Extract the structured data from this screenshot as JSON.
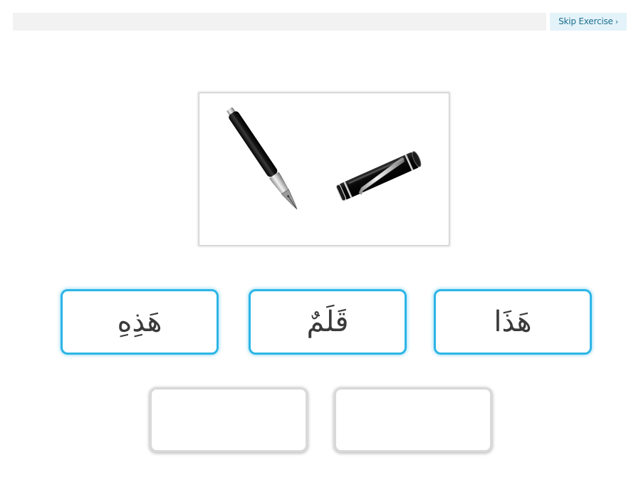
{
  "toolbar": {
    "skip_label": "Skip Exercise",
    "skip_chevron": "›"
  },
  "progress": {
    "fraction": 0.0
  },
  "picture": {
    "subject_icon": "fountain-pen-icon"
  },
  "word_bank": [
    {
      "text": "هَذِهِ"
    },
    {
      "text": "قَلَمٌ"
    },
    {
      "text": "هَذَا"
    }
  ],
  "answer_slots": [
    {
      "text": ""
    },
    {
      "text": ""
    }
  ],
  "colors": {
    "card_border": "#2db5e6",
    "slot_border": "#d9d9d9",
    "skip_bg": "#e4f3fa",
    "skip_text": "#1d6f8f",
    "track": "#f2f2f2"
  }
}
